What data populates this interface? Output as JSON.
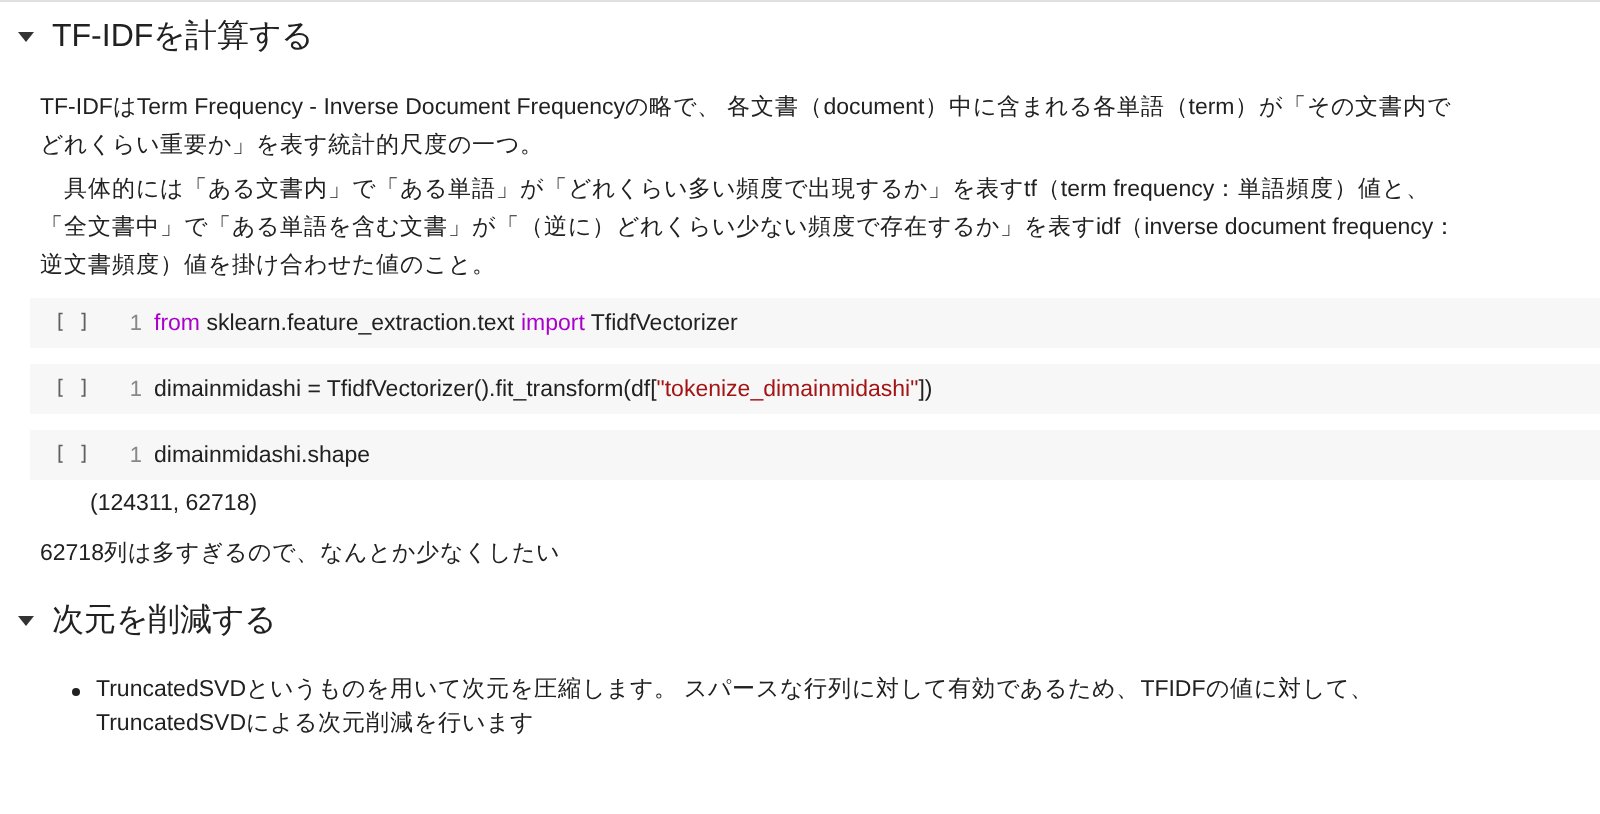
{
  "sections": [
    {
      "kind": "heading",
      "expanded": true,
      "title": "TF-IDFを計算する"
    },
    {
      "kind": "text",
      "paragraphs": [
        "TF-IDFはTerm Frequency - Inverse Document Frequencyの略で、 各文書（document）中に含まれる各単語（term）が「その文書内でどれくらい重要か」を表す統計的尺度の一つ。",
        "　具体的には「ある文書内」で「ある単語」が「どれくらい多い頻度で出現するか」を表すtf（term frequency：単語頻度）値と、「全文書中」で「ある単語を含む文書」が「（逆に）どれくらい少ない頻度で存在するか」を表すidf（inverse document frequency：逆文書頻度）値を掛け合わせた値のこと。"
      ]
    },
    {
      "kind": "code",
      "run_label": "[ ]",
      "line_number": "1",
      "tokens": [
        {
          "kind": "keyword",
          "text": "from"
        },
        {
          "kind": "plain",
          "text": " sklearn.feature_extraction.text "
        },
        {
          "kind": "keyword",
          "text": "import"
        },
        {
          "kind": "plain",
          "text": " TfidfVectorizer"
        }
      ]
    },
    {
      "kind": "code",
      "run_label": "[ ]",
      "line_number": "1",
      "tokens": [
        {
          "kind": "plain",
          "text": "dimainmidashi = TfidfVectorizer().fit_transform(df["
        },
        {
          "kind": "string",
          "text": "\"tokenize_dimainmidashi\""
        },
        {
          "kind": "plain",
          "text": "])"
        }
      ]
    },
    {
      "kind": "code",
      "run_label": "[ ]",
      "line_number": "1",
      "tokens": [
        {
          "kind": "plain",
          "text": "dimainmidashi.shape"
        }
      ],
      "output": "(124311, 62718)"
    },
    {
      "kind": "text",
      "paragraphs": [
        "62718列は多すぎるので、なんとか少なくしたい"
      ]
    },
    {
      "kind": "heading",
      "expanded": true,
      "title": "次元を削減する"
    },
    {
      "kind": "bullets",
      "items": [
        "TruncatedSVDというものを用いて次元を圧縮します。 スパースな行列に対して有効であるため、TFIDFの値に対して、TruncatedSVDによる次元削減を行います"
      ]
    }
  ]
}
